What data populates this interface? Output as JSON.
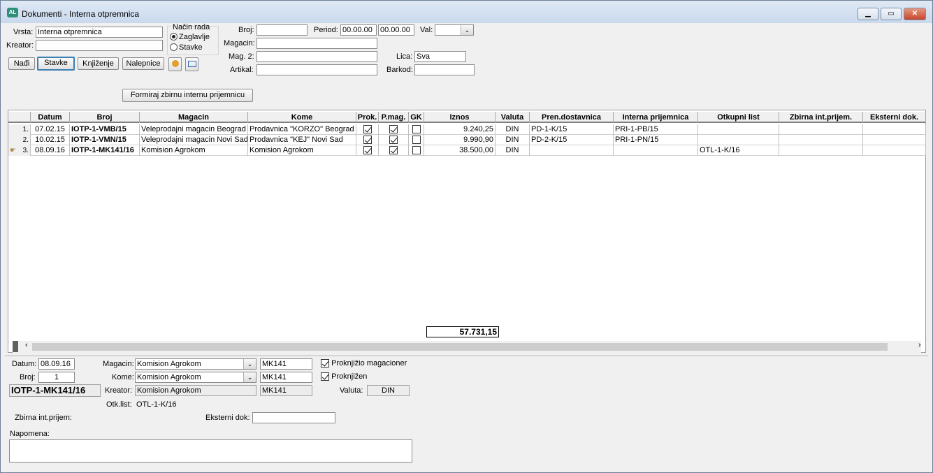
{
  "window": {
    "title": "Dokumenti - Interna otpremnica",
    "icon": "app-logo-icon"
  },
  "filters": {
    "vrsta_label": "Vrsta:",
    "vrsta_value": "Interna otpremnica",
    "kreator_label": "Kreator:",
    "kreator_value": "",
    "nacin_rada_label": "Način rada",
    "mode_zaglavlje": "Zaglavlje",
    "mode_stavke": "Stavke",
    "broj_label": "Broj:",
    "broj_value": "",
    "period_label": "Period:",
    "period_from": "00.00.00",
    "period_to": "00.00.00",
    "val_label": "Val:",
    "val_value": "",
    "magacin_label": "Magacin:",
    "magacin_value": "",
    "mag2_label": "Mag. 2:",
    "mag2_value": "",
    "lica_label": "Lica:",
    "lica_value": "Sva",
    "artikal_label": "Artikal:",
    "artikal_value": "",
    "barkod_label": "Barkod:",
    "barkod_value": ""
  },
  "toolbar": {
    "nadji": "Nađi",
    "stavke": "Stavke",
    "knjizenje": "Knjiženje",
    "nalepnice": "Nalepnice",
    "formiraj": "Formiraj zbirnu internu prijemnicu"
  },
  "grid": {
    "columns": [
      "Datum",
      "Broj",
      "Magacin",
      "Kome",
      "Prok.",
      "P.mag.",
      "GK",
      "Iznos",
      "Valuta",
      "Pren.dostavnica",
      "Interna prijemnica",
      "Otkupni list",
      "Zbirna int.prijem.",
      "Eksterni dok."
    ],
    "rows": [
      {
        "idx": "1.",
        "datum": "07.02.15",
        "broj": "IOTP-1-VMB/15",
        "magacin": "Veleprodajni magacin Beograd",
        "kome": "Prodavnica \"KORZO\" Beograd",
        "prok": true,
        "pmag": true,
        "gk": false,
        "iznos": "9.240,25",
        "valuta": "DIN",
        "pren": "PD-1-K/15",
        "interna": "PRI-1-PB/15",
        "otkupni": "",
        "zbirna": "",
        "eksterni": ""
      },
      {
        "idx": "2.",
        "datum": "10.02.15",
        "broj": "IOTP-1-VMN/15",
        "magacin": "Veleprodajni magacin Novi Sad",
        "kome": "Prodavnica \"KEJ\" Novi Sad",
        "prok": true,
        "pmag": true,
        "gk": false,
        "iznos": "9.990,90",
        "valuta": "DIN",
        "pren": "PD-2-K/15",
        "interna": "PRI-1-PN/15",
        "otkupni": "",
        "zbirna": "",
        "eksterni": ""
      },
      {
        "idx": "3.",
        "datum": "08.09.16",
        "broj": "IOTP-1-MK141/16",
        "magacin": "Komision Agrokom",
        "kome": "Komision Agrokom",
        "prok": true,
        "pmag": true,
        "gk": false,
        "iznos": "38.500,00",
        "valuta": "DIN",
        "pren": "",
        "interna": "",
        "otkupni": "OTL-1-K/16",
        "zbirna": "",
        "eksterni": ""
      }
    ],
    "total": "57.731,15"
  },
  "detail": {
    "datum_label": "Datum:",
    "datum_value": "08.09.16",
    "broj_label": "Broj:",
    "broj_value": "1",
    "doc_number": "IOTP-1-MK141/16",
    "magacin_label": "Magacin:",
    "magacin_value": "Komision Agrokom",
    "magacin_code": "MK141",
    "kome_label": "Kome:",
    "kome_value": "Komision Agrokom",
    "kome_code": "MK141",
    "kreator_label": "Kreator:",
    "kreator_value": "Komision Agrokom",
    "kreator_code": "MK141",
    "otk_label": "Otk.list:",
    "otk_value": "OTL-1-K/16",
    "proknjizio_label": "Proknjižio magacioner",
    "proknjizen_label": "Proknjižen",
    "valuta_label": "Valuta:",
    "valuta_value": "DIN",
    "zbirna_label": "Zbirna int.prijem:",
    "eksterni_label": "Eksterni dok:",
    "eksterni_value": "",
    "napomena_label": "Napomena:",
    "napomena_value": ""
  }
}
